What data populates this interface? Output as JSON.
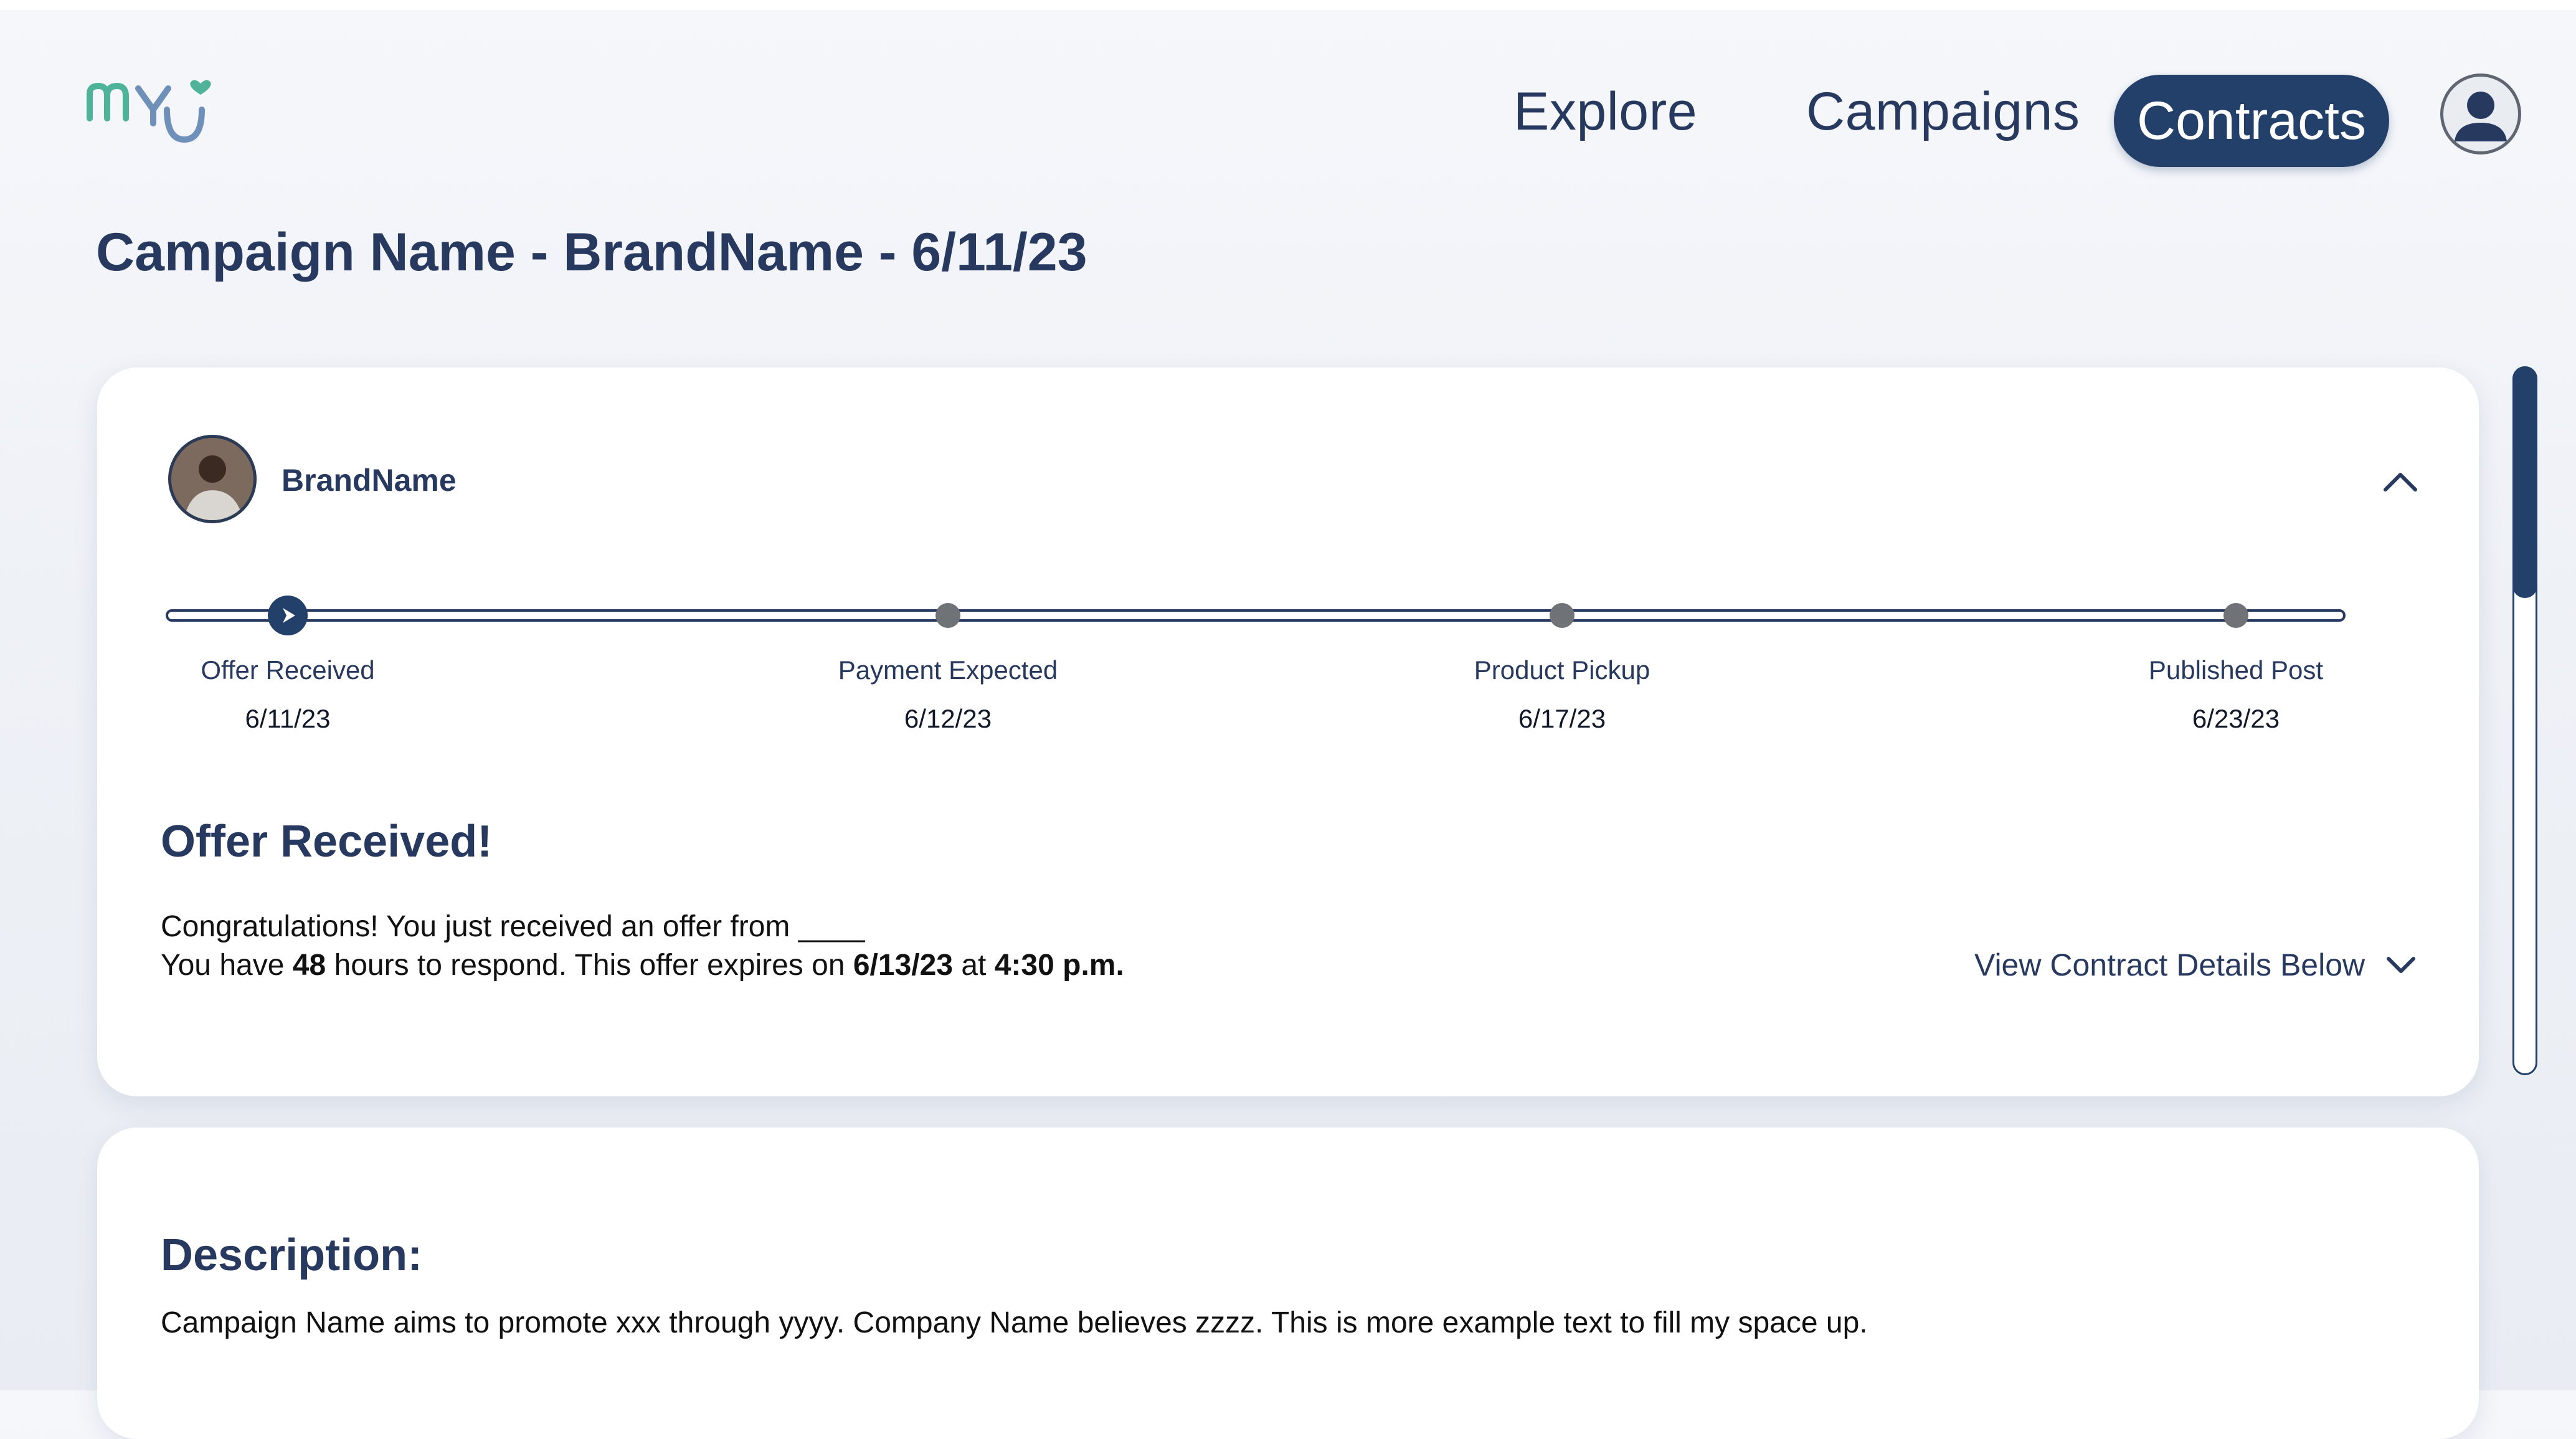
{
  "header": {
    "nav": {
      "explore": "Explore",
      "campaigns": "Campaigns",
      "contracts": "Contracts"
    }
  },
  "page": {
    "title": "Campaign Name - BrandName - 6/11/23"
  },
  "status_card": {
    "brand_name": "BrandName",
    "steps": [
      {
        "label": "Offer Received",
        "date": "6/11/23",
        "current": true
      },
      {
        "label": "Payment Expected",
        "date": "6/12/23",
        "current": false
      },
      {
        "label": "Product Pickup",
        "date": "6/17/23",
        "current": false
      },
      {
        "label": "Published Post",
        "date": "6/23/23",
        "current": false
      }
    ],
    "offer_heading": "Offer Received!",
    "congrats_text": "Congratulations! You just received an offer from ____",
    "respond_prefix": "You have ",
    "respond_hours": "48",
    "respond_mid": " hours to respond. This offer expires on ",
    "expiry_date": "6/13/23",
    "respond_at": " at ",
    "expiry_time": "4:30 p.m.",
    "view_details": "View Contract Details Below"
  },
  "description_card": {
    "heading": "Description:",
    "text": "Campaign Name aims to promote xxx through yyyy. Company Name believes zzzz. This is more example text to fill my space up."
  },
  "icons": {
    "logo": "myu-logo",
    "profile": "user-icon",
    "collapse": "chevron-up-icon",
    "expand": "chevron-down-icon",
    "current_step": "play-icon"
  },
  "colors": {
    "primary": "#23406b",
    "text": "#27395e",
    "logo_accent": "#4fb39a",
    "logo_main": "#6e90b9",
    "inactive_node": "#6f7276"
  }
}
